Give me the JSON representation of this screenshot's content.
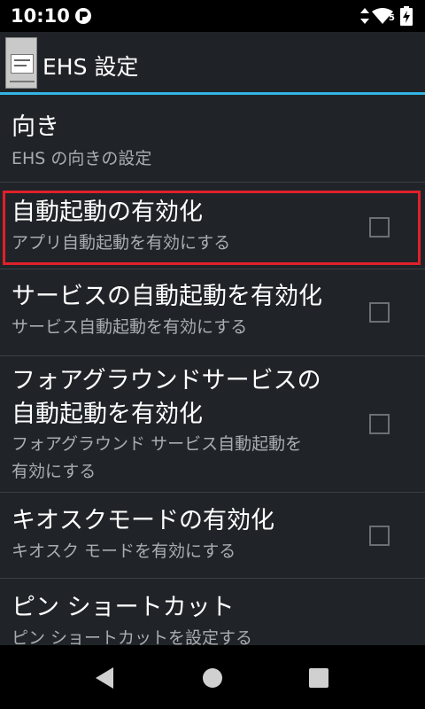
{
  "status_bar": {
    "time": "10:10",
    "icons": [
      "app-notification-icon",
      "data-transfer-icon",
      "wifi-icon",
      "battery-charging-icon"
    ],
    "signal_label": "5"
  },
  "action_bar": {
    "title": "EHS 設定"
  },
  "preferences": [
    {
      "title": "向き",
      "summary": "EHS の向きの設定",
      "has_checkbox": false
    },
    {
      "title": "自動起動の有効化",
      "summary": "アプリ自動起動を有効にする",
      "has_checkbox": true,
      "checked": false,
      "highlighted": true
    },
    {
      "title": "サービスの自動起動を有効化",
      "summary": "サービス自動起動を有効にする",
      "has_checkbox": true,
      "checked": false
    },
    {
      "title_line1": "フォアグラウンドサービスの",
      "title_line2": "自動起動を有効化",
      "summary_line1": "フォアグラウンド サービス自動起動を",
      "summary_line2": "有効にする",
      "has_checkbox": true,
      "checked": false
    },
    {
      "title": "キオスクモードの有効化",
      "summary": "キオスク モードを有効にする",
      "has_checkbox": true,
      "checked": false
    },
    {
      "title": "ピン ショートカット",
      "summary": "ピン ショートカットを設定する",
      "has_checkbox": false
    }
  ],
  "colors": {
    "accent": "#33b5e5",
    "highlight": "#e0202a",
    "background": "#202428"
  },
  "nav_bar": {
    "icons": [
      "back-icon",
      "home-icon",
      "recents-icon"
    ]
  }
}
